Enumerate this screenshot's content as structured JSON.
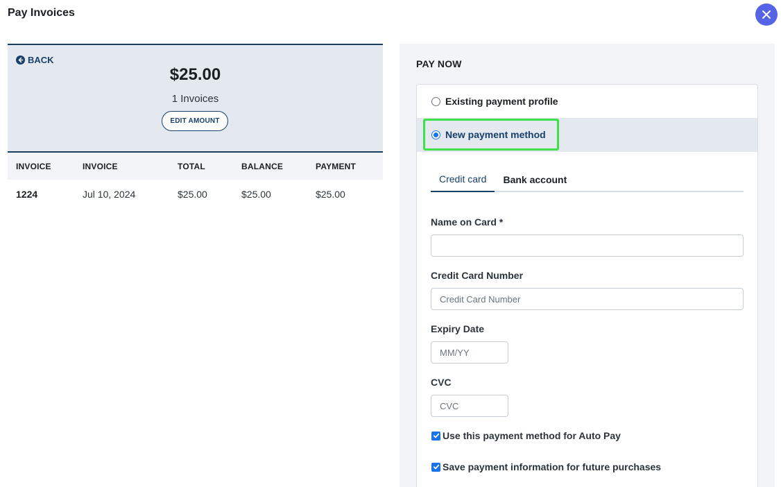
{
  "modal": {
    "title": "Pay Invoices"
  },
  "summary": {
    "back_label": "BACK",
    "amount": "$25.00",
    "invoice_count": "1 Invoices",
    "edit_amount_label": "EDIT AMOUNT"
  },
  "invoices": {
    "headers": [
      "INVOICE",
      "INVOICE",
      "TOTAL",
      "BALANCE",
      "PAYMENT"
    ],
    "rows": [
      {
        "number": "1224",
        "date": "Jul 10, 2024",
        "total": "$25.00",
        "balance": "$25.00",
        "payment": "$25.00"
      }
    ]
  },
  "pay_now": {
    "heading": "PAY NOW",
    "options": [
      {
        "label": "Existing payment profile",
        "selected": false
      },
      {
        "label": "New payment method",
        "selected": true
      }
    ],
    "tabs": [
      {
        "label": "Credit card",
        "active": true
      },
      {
        "label": "Bank account",
        "active": false
      }
    ],
    "fields": {
      "name_on_card": {
        "label": "Name on Card *",
        "value": "",
        "placeholder": ""
      },
      "card_number": {
        "label": "Credit Card Number",
        "value": "",
        "placeholder": "Credit Card Number"
      },
      "expiry": {
        "label": "Expiry Date",
        "value": "",
        "placeholder": "MM/YY"
      },
      "cvc": {
        "label": "CVC",
        "value": "",
        "placeholder": "CVC"
      }
    },
    "checkboxes": [
      {
        "label": "Use this payment method for Auto Pay",
        "checked": true
      },
      {
        "label": "Save payment information for future purchases",
        "checked": true
      }
    ]
  },
  "colors": {
    "accent": "#173f6b",
    "close_button": "#5564e6",
    "checkbox": "#1a73e8",
    "highlight": "#3ee04c"
  },
  "icons": {
    "close": "close-icon",
    "back": "arrow-left-circle-icon",
    "check": "check-icon"
  }
}
